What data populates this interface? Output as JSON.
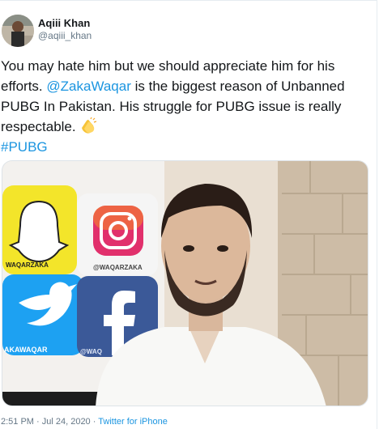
{
  "tweet": {
    "display_name": "Aqiii Khan",
    "handle": "@aqiii_khan",
    "text_part1": "You may hate him but we should appreciate him for his efforts. ",
    "mention": "@ZakaWaqar",
    "text_part2": " is the biggest reason of Unbanned PUBG  In Pakistan. His struggle for PUBG issue is really respectable. ",
    "emoji": "clapping-hands-icon",
    "hashtag": "#PUBG",
    "timestamp": "2:51 PM · Jul 24, 2020",
    "separator": " · ",
    "source": "Twitter for iPhone"
  },
  "media": {
    "pillow_labels": [
      "WAQARZAKA",
      "@WAQARZAKA",
      "AKAWAQAR",
      "@WAQ"
    ]
  },
  "colors": {
    "link": "#1b95e0",
    "text": "#14171a",
    "secondary": "#657786"
  }
}
